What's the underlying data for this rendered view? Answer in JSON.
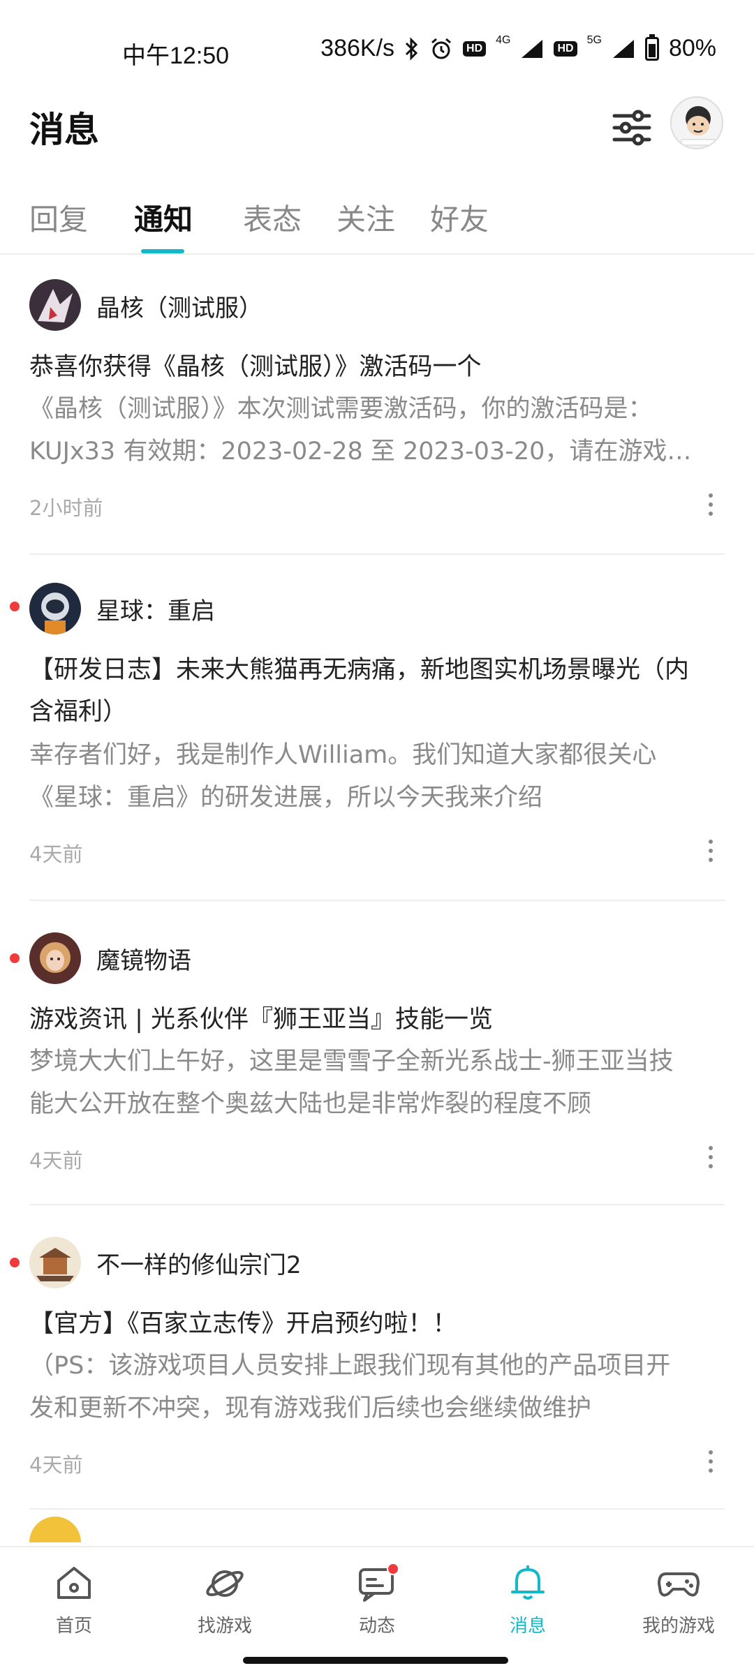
{
  "status_bar": {
    "time": "中午12:50",
    "speed": "386K/s",
    "hd_badge": "HD",
    "net_4g": "4G",
    "net_5g": "5G",
    "battery": "80%",
    "battery_level": 0.8
  },
  "header": {
    "title": "消息",
    "filter_icon": "sliders-icon",
    "avatar_icon": "user-avatar"
  },
  "tabs": [
    {
      "label": "回复"
    },
    {
      "label": "通知"
    },
    {
      "label": "表态"
    },
    {
      "label": "关注"
    },
    {
      "label": "好友"
    }
  ],
  "active_tab": "通知",
  "notices": [
    {
      "game": "晶核（测试服）",
      "unread": false,
      "title": "恭喜你获得《晶核（测试服）》激活码一个",
      "body_line1": "《晶核（测试服）》本次测试需要激活码，你的激活码是：",
      "body_line2": "KUJx33 有效期：2023-02-28 至 2023-03-20，请在游戏…",
      "time": "2小时前"
    },
    {
      "game": "星球：重启",
      "unread": true,
      "title_line1": "【研发日志】未来大熊猫再无病痛，新地图实机场景曝光（内",
      "title_line2": "含福利）",
      "body_line1": "幸存者们好，我是制作人William。我们知道大家都很关心",
      "body_line2": "《星球：重启》的研发进展，所以今天我来介绍",
      "time": "4天前"
    },
    {
      "game": "魔镜物语",
      "unread": true,
      "title": "游戏资讯 | 光系伙伴『狮王亚当』技能一览",
      "body_line1": "梦境大大们上午好，这里是雪雪子全新光系战士-狮王亚当技",
      "body_line2": "能大公开放在整个奥兹大陆也是非常炸裂的程度不顾",
      "time": "4天前"
    },
    {
      "game": "不一样的修仙宗门2",
      "unread": true,
      "title": "【官方】《百家立志传》开启预约啦！！",
      "body_line1": "（PS：该游戏项目人员安排上跟我们现有其他的产品项目开",
      "body_line2": "发和更新不冲突，现有游戏我们后续也会继续做维护",
      "time": "4天前"
    }
  ],
  "bottom_nav": [
    {
      "label": "首页",
      "icon": "home-icon"
    },
    {
      "label": "找游戏",
      "icon": "planet-icon"
    },
    {
      "label": "动态",
      "icon": "chat-icon"
    },
    {
      "label": "消息",
      "icon": "bell-icon"
    },
    {
      "label": "我的游戏",
      "icon": "gamepad-icon"
    }
  ],
  "colors": {
    "accent": "#14b9c8",
    "unread": "#ef3b3b",
    "muted_text": "#8a8a8a"
  }
}
